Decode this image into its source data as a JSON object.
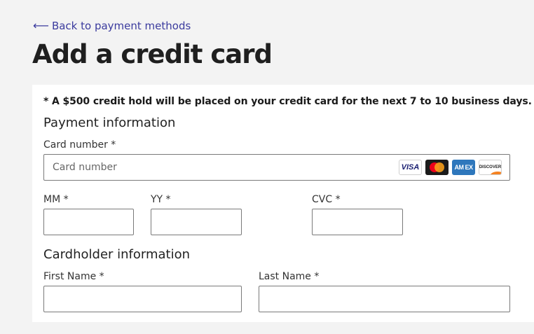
{
  "nav": {
    "back_arrow": "⟵",
    "back_label": "Back to payment methods"
  },
  "page": {
    "title": "Add a credit card"
  },
  "notice": {
    "hold_text": "* A $500 credit hold will be placed on your credit card for the next 7 to 10 business days."
  },
  "payment": {
    "section_title": "Payment information",
    "card_number_label": "Card number *",
    "card_number_placeholder": "Card number",
    "card_number_value": "",
    "brands": [
      {
        "name": "visa-icon",
        "label": "VISA"
      },
      {
        "name": "mastercard-icon",
        "label": ""
      },
      {
        "name": "amex-icon",
        "label": "AM EX"
      },
      {
        "name": "discover-icon",
        "label": "DISCOVER"
      }
    ],
    "mm_label": "MM *",
    "mm_value": "",
    "yy_label": "YY *",
    "yy_value": "",
    "cvc_label": "CVC *",
    "cvc_value": ""
  },
  "cardholder": {
    "section_title": "Cardholder information",
    "first_name_label": "First Name *",
    "first_name_value": "",
    "last_name_label": "Last Name *",
    "last_name_value": ""
  },
  "colors": {
    "link": "#3b3b9e",
    "page_bg": "#f3f3f3",
    "panel_bg": "#ffffff",
    "input_border": "#7a7a7a"
  }
}
